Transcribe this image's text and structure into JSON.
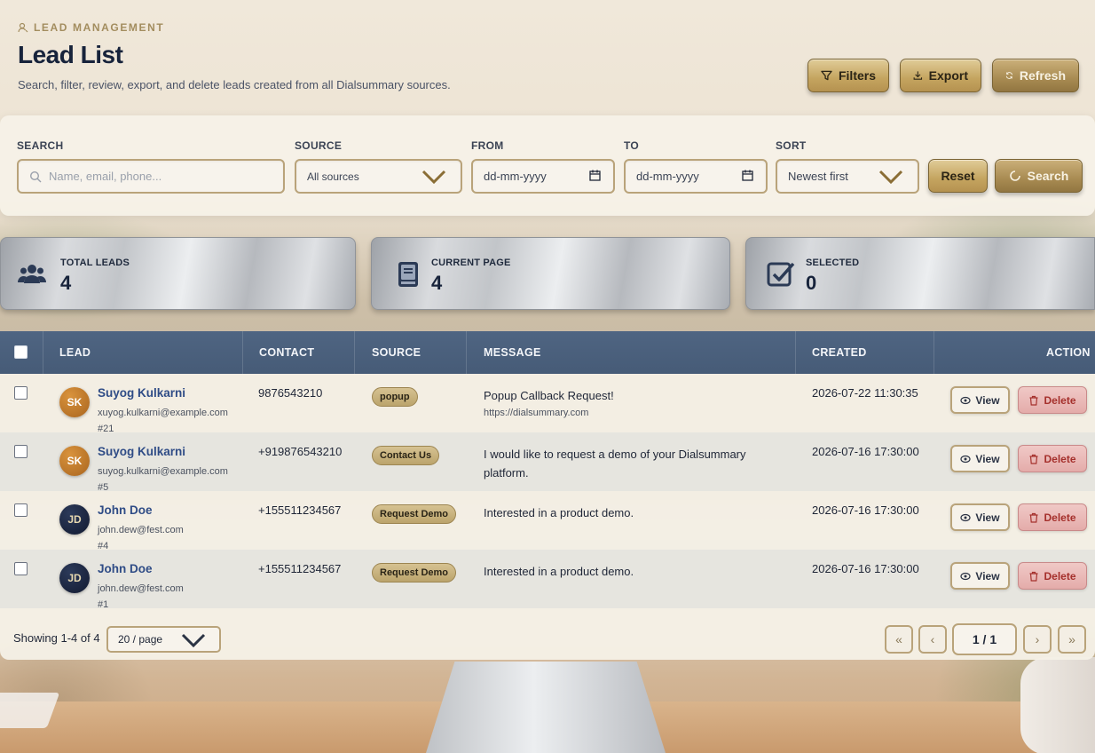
{
  "header": {
    "eyebrow": "LEAD MANAGEMENT",
    "title": "Lead List",
    "subtitle": "Search, filter, review, export, and delete leads created from all Dialsummary sources."
  },
  "actions": {
    "filters": "Filters",
    "export": "Export",
    "refresh": "Refresh"
  },
  "filters": {
    "search_label": "SEARCH",
    "search_placeholder": "Name, email, phone...",
    "source_label": "SOURCE",
    "source_value": "All sources",
    "from_label": "FROM",
    "from_value": "dd-mm-yyyy",
    "to_label": "TO",
    "to_value": "dd-mm-yyyy",
    "sort_label": "SORT",
    "sort_value": "Newest first",
    "reset": "Reset",
    "search": "Search"
  },
  "stats": [
    {
      "label": "TOTAL LEADS",
      "value": "4",
      "icon": "users-icon"
    },
    {
      "label": "CURRENT PAGE",
      "value": "4",
      "icon": "book-icon"
    },
    {
      "label": "SELECTED",
      "value": "0",
      "icon": "check-square-icon"
    }
  ],
  "table": {
    "columns": [
      "LEAD",
      "CONTACT",
      "SOURCE",
      "MESSAGE",
      "CREATED",
      "ACTION"
    ],
    "view_label": "View",
    "delete_label": "Delete",
    "rows": [
      {
        "initials": "SK",
        "name": "Suyog Kulkarni",
        "email": "xuyog.kulkarni@example.com",
        "id": "#21",
        "contact": "9876543210",
        "source": "popup",
        "message": "Popup Callback Request!",
        "message_sub": "https://dialsummary.com",
        "created": "2026-07-22 11:30:35"
      },
      {
        "initials": "SK",
        "name": "Suyog Kulkarni",
        "email": "suyog.kulkarni@example.com",
        "id": "#5",
        "contact": "+919876543210",
        "source": "Contact Us",
        "message": "I would like to request a demo of your Dialsummary platform.",
        "message_sub": "",
        "created": "2026-07-16 17:30:00"
      },
      {
        "initials": "JD",
        "name": "John Doe",
        "email": "john.dew@fest.com",
        "id": "#4",
        "contact": "+155511234567",
        "source": "Request Demo",
        "message": "Interested in a product demo.",
        "message_sub": "",
        "created": "2026-07-16 17:30:00"
      },
      {
        "initials": "JD",
        "name": "John Doe",
        "email": "john.dew@fest.com",
        "id": "#1",
        "contact": "+155511234567",
        "source": "Request Demo",
        "message": "Interested in a product demo.",
        "message_sub": "",
        "created": "2026-07-16 17:30:00"
      }
    ]
  },
  "pagination": {
    "showing": "Showing 1-4 of 4",
    "per_page": "20 / page",
    "current": "1 / 1",
    "first": "«",
    "prev": "‹",
    "next": "›",
    "last": "»"
  },
  "colors": {
    "accent_gold": "#c4a45f",
    "table_header": "#4f6582",
    "delete_red": "#a5302c",
    "link_blue": "#2f4c86"
  }
}
